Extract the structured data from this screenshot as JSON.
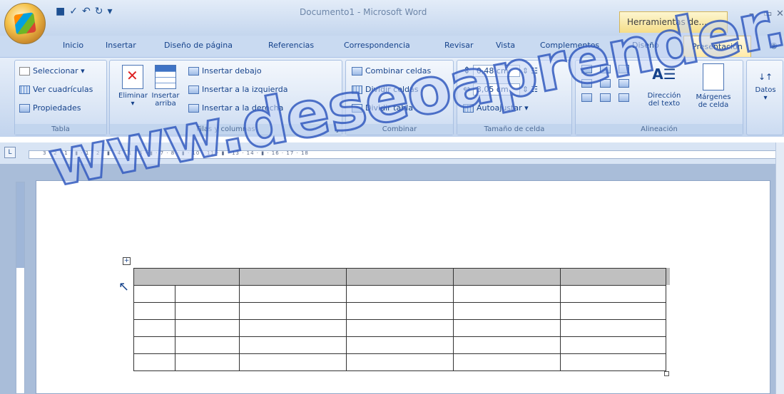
{
  "window": {
    "title": "Documento1 - Microsoft Word",
    "tools_tab": "Herramientas de...",
    "controls": [
      "–",
      "▭",
      "✕"
    ]
  },
  "qat": {
    "icons": [
      "save-icon",
      "undo-icon",
      "redo-icon",
      "customize-icon"
    ]
  },
  "tabs": [
    {
      "label": "Inicio",
      "active": false
    },
    {
      "label": "Insertar",
      "active": false
    },
    {
      "label": "Diseño de página",
      "active": false
    },
    {
      "label": "Referencias",
      "active": false
    },
    {
      "label": "Correspondencia",
      "active": false
    },
    {
      "label": "Revisar",
      "active": false
    },
    {
      "label": "Vista",
      "active": false
    },
    {
      "label": "Complementos",
      "active": false
    },
    {
      "label": "Diseño",
      "active": false
    },
    {
      "label": "Presentación",
      "active": true
    }
  ],
  "ribbon": {
    "tabla": {
      "label": "Tabla",
      "items": [
        "Seleccionar ▾",
        "Ver cuadrículas",
        "Propiedades"
      ]
    },
    "filas": {
      "label": "Filas y columnas",
      "eliminar": "Eliminar",
      "insertar_arriba_1": "Insertar",
      "insertar_arriba_2": "arriba",
      "items": [
        "Insertar debajo",
        "Insertar a la izquierda",
        "Insertar a la derecha"
      ]
    },
    "combinar": {
      "label": "Combinar",
      "items": [
        "Combinar celdas",
        "Dividir celdas",
        "Dividir tabla"
      ]
    },
    "tamano": {
      "label": "Tamaño de celda",
      "height": "0,48 cm",
      "width": "3,05 cm",
      "autofit": "Autoajustar ▾"
    },
    "alineacion": {
      "label": "Alineación",
      "direccion_1": "Dirección",
      "direccion_2": "del texto",
      "margenes_1": "Márgenes",
      "margenes_2": "de celda"
    },
    "datos": {
      "label": "Datos"
    }
  },
  "ruler": {
    "ticks": "3 · 2 · 1 · ▮ · 1 · 2 · ▮ · 4 · 1 · 5 · ▮ · 7 · 8 · ▮ · 10 · 11 · ▮ · 13 · 14 · ▮ · 16 · 17 · 18"
  },
  "watermark": "www.deseoaprender.com",
  "document": {
    "table": {
      "rows": 6,
      "cols": 5
    }
  },
  "colors": {
    "accent": "#15428b",
    "ribbon": "#cddcf1",
    "active_tab": "#ffeaa6",
    "table_header": "#c0c0c0"
  }
}
